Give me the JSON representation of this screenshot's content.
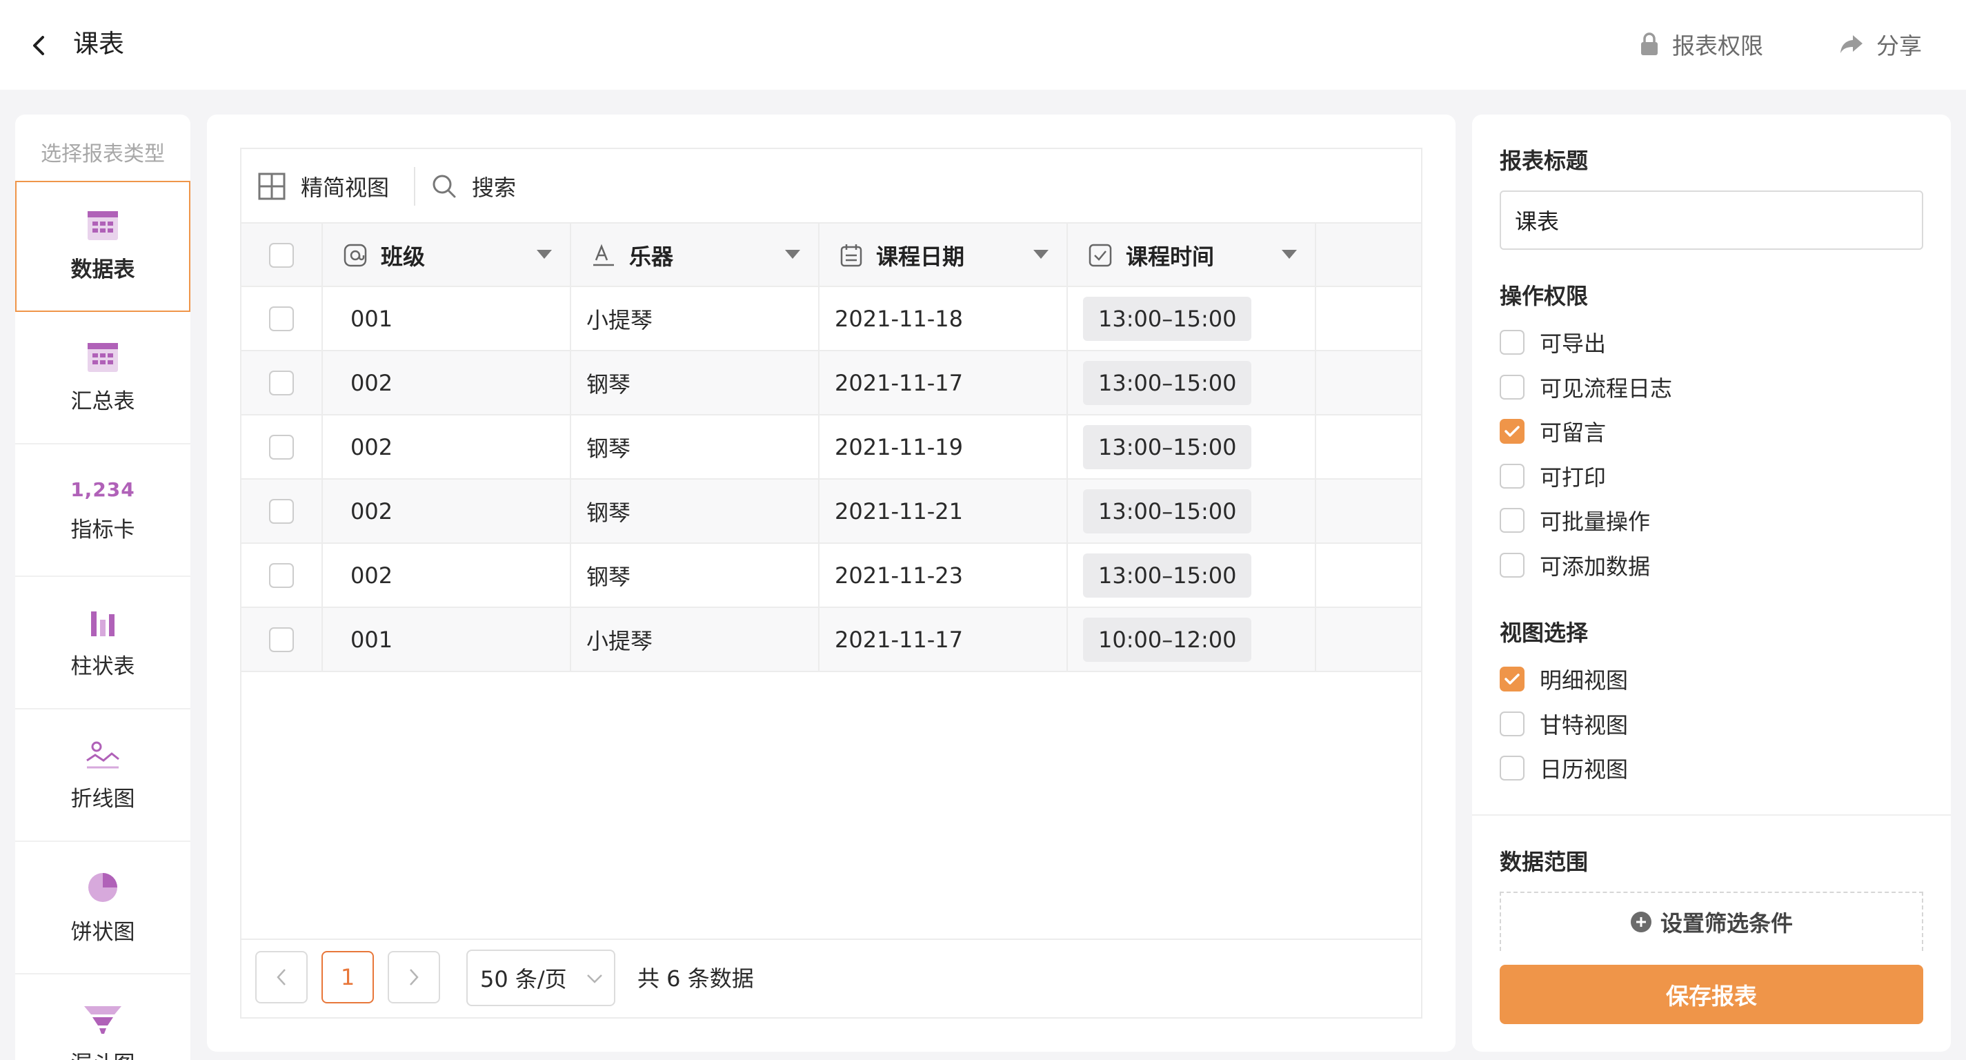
{
  "header": {
    "title": "课表",
    "permission_label": "报表权限",
    "share_label": "分享"
  },
  "sidebar": {
    "title": "选择报表类型",
    "metric_sample": "1,234",
    "items": [
      {
        "label": "数据表",
        "icon": "table-icon",
        "active": true
      },
      {
        "label": "汇总表",
        "icon": "summary-table-icon",
        "active": false
      },
      {
        "label": "指标卡",
        "icon": "metric-card-icon",
        "active": false
      },
      {
        "label": "柱状表",
        "icon": "bar-chart-icon",
        "active": false
      },
      {
        "label": "折线图",
        "icon": "line-chart-icon",
        "active": false
      },
      {
        "label": "饼状图",
        "icon": "pie-chart-icon",
        "active": false
      },
      {
        "label": "漏斗图",
        "icon": "funnel-chart-icon",
        "active": false
      }
    ]
  },
  "toolbar": {
    "view_label": "精简视图",
    "search_label": "搜索"
  },
  "table": {
    "columns": [
      {
        "label": "班级",
        "icon": "at-icon"
      },
      {
        "label": "乐器",
        "icon": "text-field-icon"
      },
      {
        "label": "课程日期",
        "icon": "calendar-icon"
      },
      {
        "label": "课程时间",
        "icon": "clock-icon"
      }
    ],
    "rows": [
      {
        "class": "001",
        "instrument": "小提琴",
        "date": "2021-11-18",
        "time": "13:00–15:00"
      },
      {
        "class": "002",
        "instrument": "钢琴",
        "date": "2021-11-17",
        "time": "13:00–15:00"
      },
      {
        "class": "002",
        "instrument": "钢琴",
        "date": "2021-11-19",
        "time": "13:00–15:00"
      },
      {
        "class": "002",
        "instrument": "钢琴",
        "date": "2021-11-21",
        "time": "13:00–15:00"
      },
      {
        "class": "002",
        "instrument": "钢琴",
        "date": "2021-11-23",
        "time": "13:00–15:00"
      },
      {
        "class": "001",
        "instrument": "小提琴",
        "date": "2021-11-17",
        "time": "10:00–12:00"
      }
    ]
  },
  "pagination": {
    "current_page": "1",
    "page_size": "50 条/页",
    "total": "共 6 条数据"
  },
  "settings": {
    "title_label": "报表标题",
    "title_value": "课表",
    "permissions_label": "操作权限",
    "permissions": [
      {
        "label": "可导出",
        "checked": false
      },
      {
        "label": "可见流程日志",
        "checked": false
      },
      {
        "label": "可留言",
        "checked": true
      },
      {
        "label": "可打印",
        "checked": false
      },
      {
        "label": "可批量操作",
        "checked": false
      },
      {
        "label": "可添加数据",
        "checked": false
      }
    ],
    "views_label": "视图选择",
    "views": [
      {
        "label": "明细视图",
        "checked": true
      },
      {
        "label": "甘特视图",
        "checked": false
      },
      {
        "label": "日历视图",
        "checked": false
      }
    ],
    "range_label": "数据范围",
    "filter_label": "设置筛选条件",
    "save_label": "保存报表"
  },
  "colors": {
    "accent": "#ef9549",
    "icon_purple": "#b061b8"
  }
}
